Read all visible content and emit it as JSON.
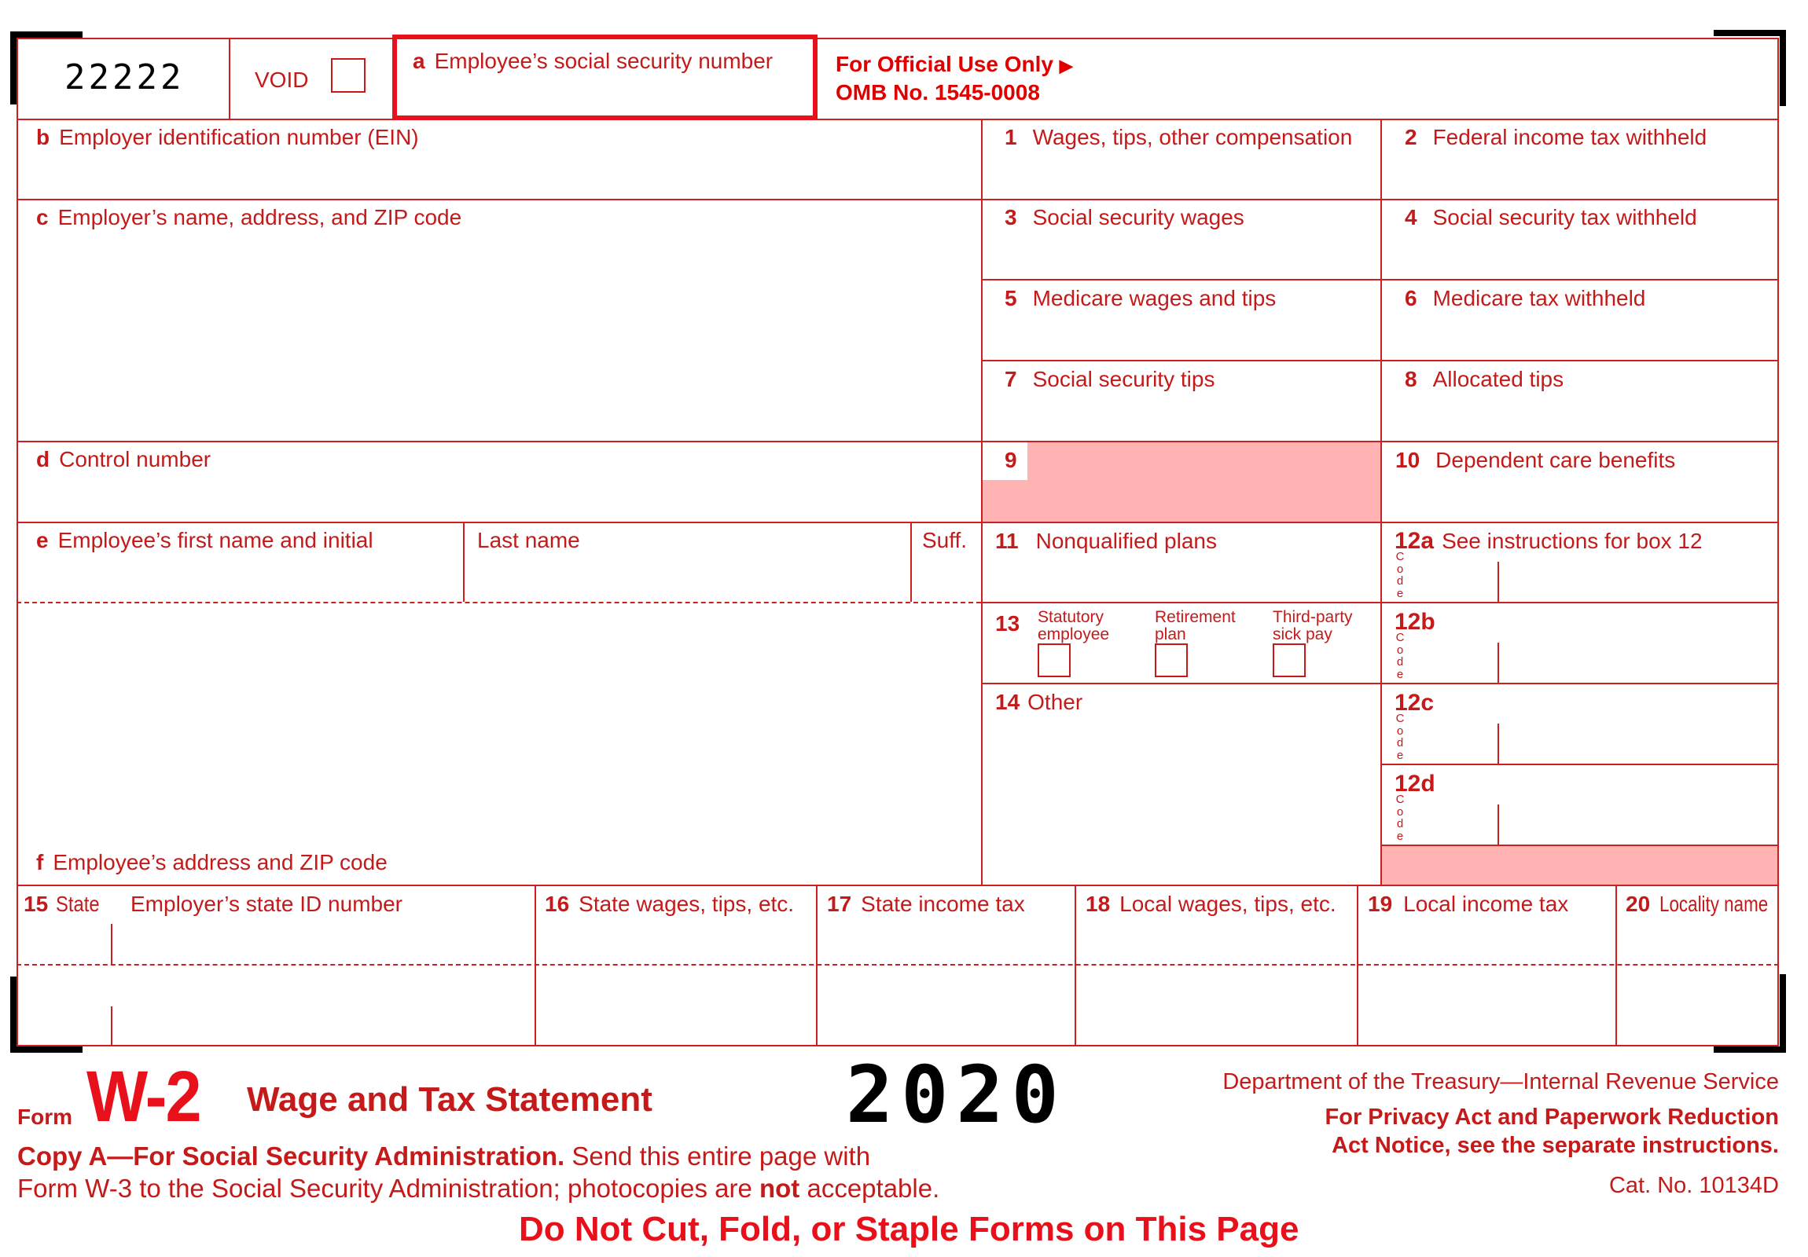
{
  "form": {
    "control_code": "22222",
    "void_label": "VOID",
    "box_a": {
      "letter": "a",
      "label": "Employee’s social security number"
    },
    "official_use": "For Official Use Only",
    "omb": "OMB No. 1545-0008",
    "box_b": {
      "letter": "b",
      "label": "Employer identification number (EIN)"
    },
    "box_c": {
      "letter": "c",
      "label": "Employer’s name, address, and ZIP code"
    },
    "box_d": {
      "letter": "d",
      "label": "Control number"
    },
    "box_e": {
      "letter": "e",
      "label": "Employee’s first name and initial",
      "last_name": "Last name",
      "suffix": "Suff."
    },
    "box_f": {
      "letter": "f",
      "label": "Employee’s address and ZIP code"
    },
    "boxes": {
      "b1": {
        "num": "1",
        "label": "Wages, tips, other compensation"
      },
      "b2": {
        "num": "2",
        "label": "Federal income tax withheld"
      },
      "b3": {
        "num": "3",
        "label": "Social security wages"
      },
      "b4": {
        "num": "4",
        "label": "Social security tax withheld"
      },
      "b5": {
        "num": "5",
        "label": "Medicare wages and tips"
      },
      "b6": {
        "num": "6",
        "label": "Medicare tax withheld"
      },
      "b7": {
        "num": "7",
        "label": "Social security tips"
      },
      "b8": {
        "num": "8",
        "label": "Allocated tips"
      },
      "b9": {
        "num": "9",
        "label": ""
      },
      "b10": {
        "num": "10",
        "label": "Dependent care benefits"
      },
      "b11": {
        "num": "11",
        "label": "Nonqualified plans"
      },
      "b12a": {
        "num": "12a",
        "label": "See instructions for box 12"
      },
      "b12b": {
        "num": "12b",
        "label": ""
      },
      "b12c": {
        "num": "12c",
        "label": ""
      },
      "b12d": {
        "num": "12d",
        "label": ""
      },
      "b13": {
        "num": "13",
        "statutory_1": "Statutory",
        "statutory_2": "employee",
        "retirement_1": "Retirement",
        "retirement_2": "plan",
        "thirdparty_1": "Third-party",
        "thirdparty_2": "sick pay"
      },
      "b14": {
        "num": "14",
        "label": "Other"
      },
      "b15": {
        "num": "15",
        "label": "State",
        "label2": "Employer’s state ID number"
      },
      "b16": {
        "num": "16",
        "label": "State wages, tips, etc."
      },
      "b17": {
        "num": "17",
        "label": "State income tax"
      },
      "b18": {
        "num": "18",
        "label": "Local wages, tips, etc."
      },
      "b19": {
        "num": "19",
        "label": "Local income tax"
      },
      "b20": {
        "num": "20",
        "label": "Locality name"
      }
    },
    "code_vertical": [
      "C",
      "o",
      "d",
      "e"
    ]
  },
  "footer": {
    "form_word": "Form",
    "form_name": "W-2",
    "title": "Wage and Tax Statement",
    "year": "2020",
    "dept": "Department of the Treasury—Internal Revenue Service",
    "privacy_1": "For Privacy Act and Paperwork Reduction",
    "privacy_2": "Act Notice, see the separate instructions.",
    "cat_no": "Cat. No. 10134D",
    "copy_bold": "Copy A—For Social Security Administration.",
    "copy_rest": " Send this entire page with",
    "copy_line2_a": "Form W-3 to the Social Security Administration; photocopies are ",
    "copy_line2_bold": "not",
    "copy_line2_b": " acceptable.",
    "warning": "Do Not Cut, Fold, or Staple Forms on This Page"
  },
  "colors": {
    "form_red": "#c41a1a",
    "shade_pink": "#ffb3b3",
    "brand_red": "#e8101a"
  }
}
